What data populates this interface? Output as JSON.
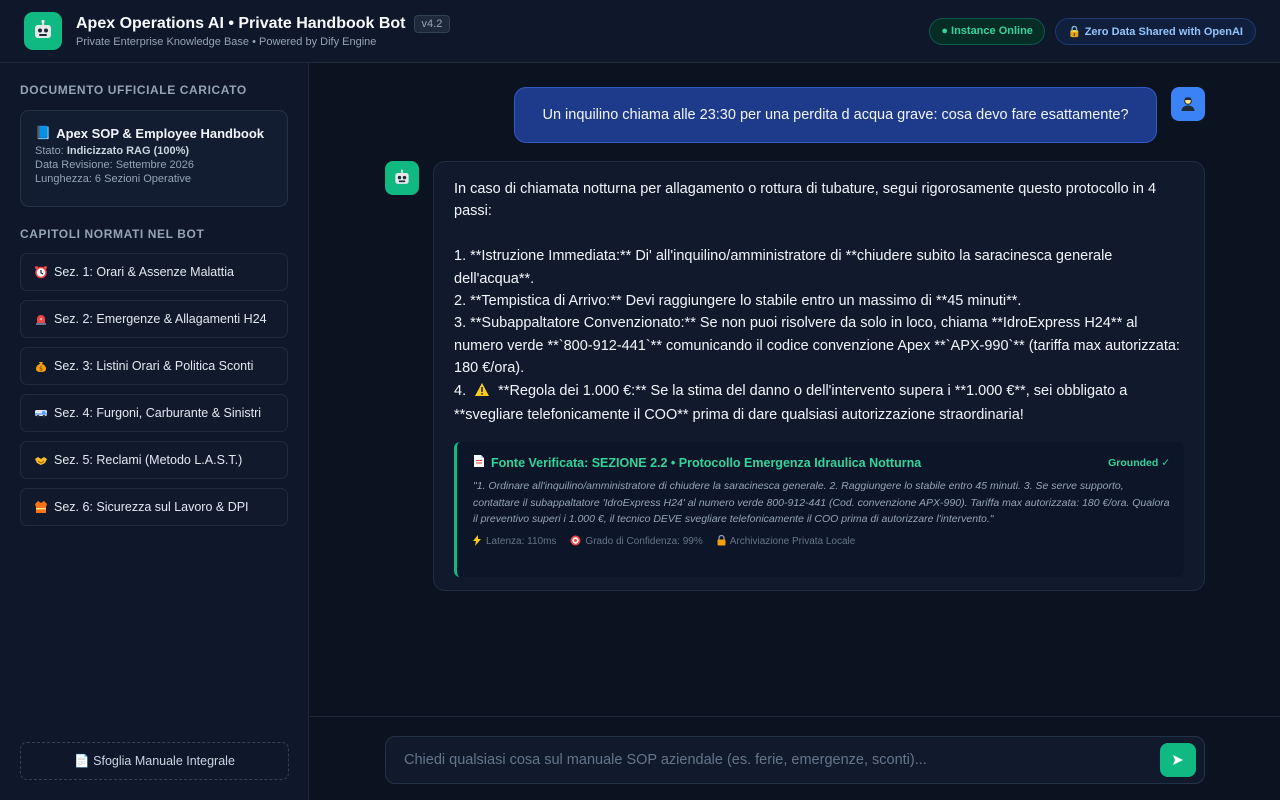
{
  "header": {
    "title": "Apex Operations AI • Private Handbook Bot",
    "version": "v4.2",
    "subtitle": "Private Enterprise Knowledge Base • Powered by Dify Engine",
    "status_badge": "● Instance Online",
    "privacy_badge": "Zero Data Shared with OpenAI",
    "logo_icon": "robot-icon"
  },
  "sidebar": {
    "doc_section_title": "Documento Ufficiale Caricato",
    "doc": {
      "title": "Apex SOP & Employee Handbook",
      "status_label": "Stato:",
      "status_value": "Indicizzato RAG (100%)",
      "revision": "Data Revisione: Settembre 2026",
      "length": "Lunghezza: 6 Sezioni Operative"
    },
    "chapters_title": "Capitoli Normati nel Bot",
    "chapters": [
      {
        "label": "Sez. 1: Orari & Assenze Malattia",
        "icon": "alarm-clock-icon"
      },
      {
        "label": "Sez. 2: Emergenze & Allagamenti H24",
        "icon": "siren-icon"
      },
      {
        "label": "Sez. 3: Listini Orari & Politica Sconti",
        "icon": "money-bag-icon"
      },
      {
        "label": "Sez. 4: Furgoni, Carburante & Sinistri",
        "icon": "van-icon"
      },
      {
        "label": "Sez. 5: Reclami (Metodo L.A.S.T.)",
        "icon": "handshake-icon"
      },
      {
        "label": "Sez. 6: Sicurezza sul Lavoro & DPI",
        "icon": "safety-vest-icon"
      }
    ],
    "manual_button": "📄 Sfoglia Manuale Integrale"
  },
  "chat": {
    "user_message": "Un inquilino chiama alle 23:30 per una perdita d acqua grave: cosa devo fare esattamente?",
    "bot_message": {
      "intro": "In caso di chiamata notturna per allagamento o rottura di tubature, segui rigorosamente questo protocollo in 4 passi:",
      "step1": "1. **Istruzione Immediata:** Di' all'inquilino/amministratore di **chiudere subito la saracinesca generale dell'acqua**.",
      "step2": "2. **Tempistica di Arrivo:** Devi raggiungere lo stabile entro un massimo di **45 minuti**.",
      "step3": "3. **Subappaltatore Convenzionato:** Se non puoi risolvere da solo in loco, chiama **IdroExpress H24** al numero verde **`800-912-441`** comunicando il codice convenzione Apex **`APX-990`** (tariffa max autorizzata: 180 €/ora).",
      "step4_prefix": "4.",
      "step4": "**Regola dei 1.000 €:** Se la stima del danno o dell'intervento supera i **1.000 €**, sei obbligato a **svegliare telefonicamente il COO** prima di dare qualsiasi autorizzazione straordinaria!"
    },
    "source": {
      "title": "Fonte Verificata: SEZIONE 2.2 • Protocollo Emergenza Idraulica Notturna",
      "grounded": "Grounded ✓",
      "quote": "\"1. Ordinare all'inquilino/amministratore di chiudere la saracinesca generale. 2. Raggiungere lo stabile entro 45 minuti. 3. Se serve supporto, contattare il subappaltatore 'IdroExpress H24' al numero verde 800-912-441 (Cod. convenzione APX-990). Tariffa max autorizzata: 180 €/ora. Qualora il preventivo superi i 1.000 €, il tecnico DEVE svegliare telefonicamente il COO prima di autorizzare l'intervento.\"",
      "latency": "Latenza: 110ms",
      "confidence": "Grado di Confidenza: 99%",
      "storage": "Archiviazione Privata Locale"
    }
  },
  "input": {
    "placeholder": "Chiedi qualsiasi cosa sul manuale SOP aziendale (es. ferie, emergenze, sconti)...",
    "value": ""
  },
  "colors": {
    "accent_green": "#10b981",
    "user_bubble": "#1e3a8a",
    "background": "#0b1220"
  }
}
